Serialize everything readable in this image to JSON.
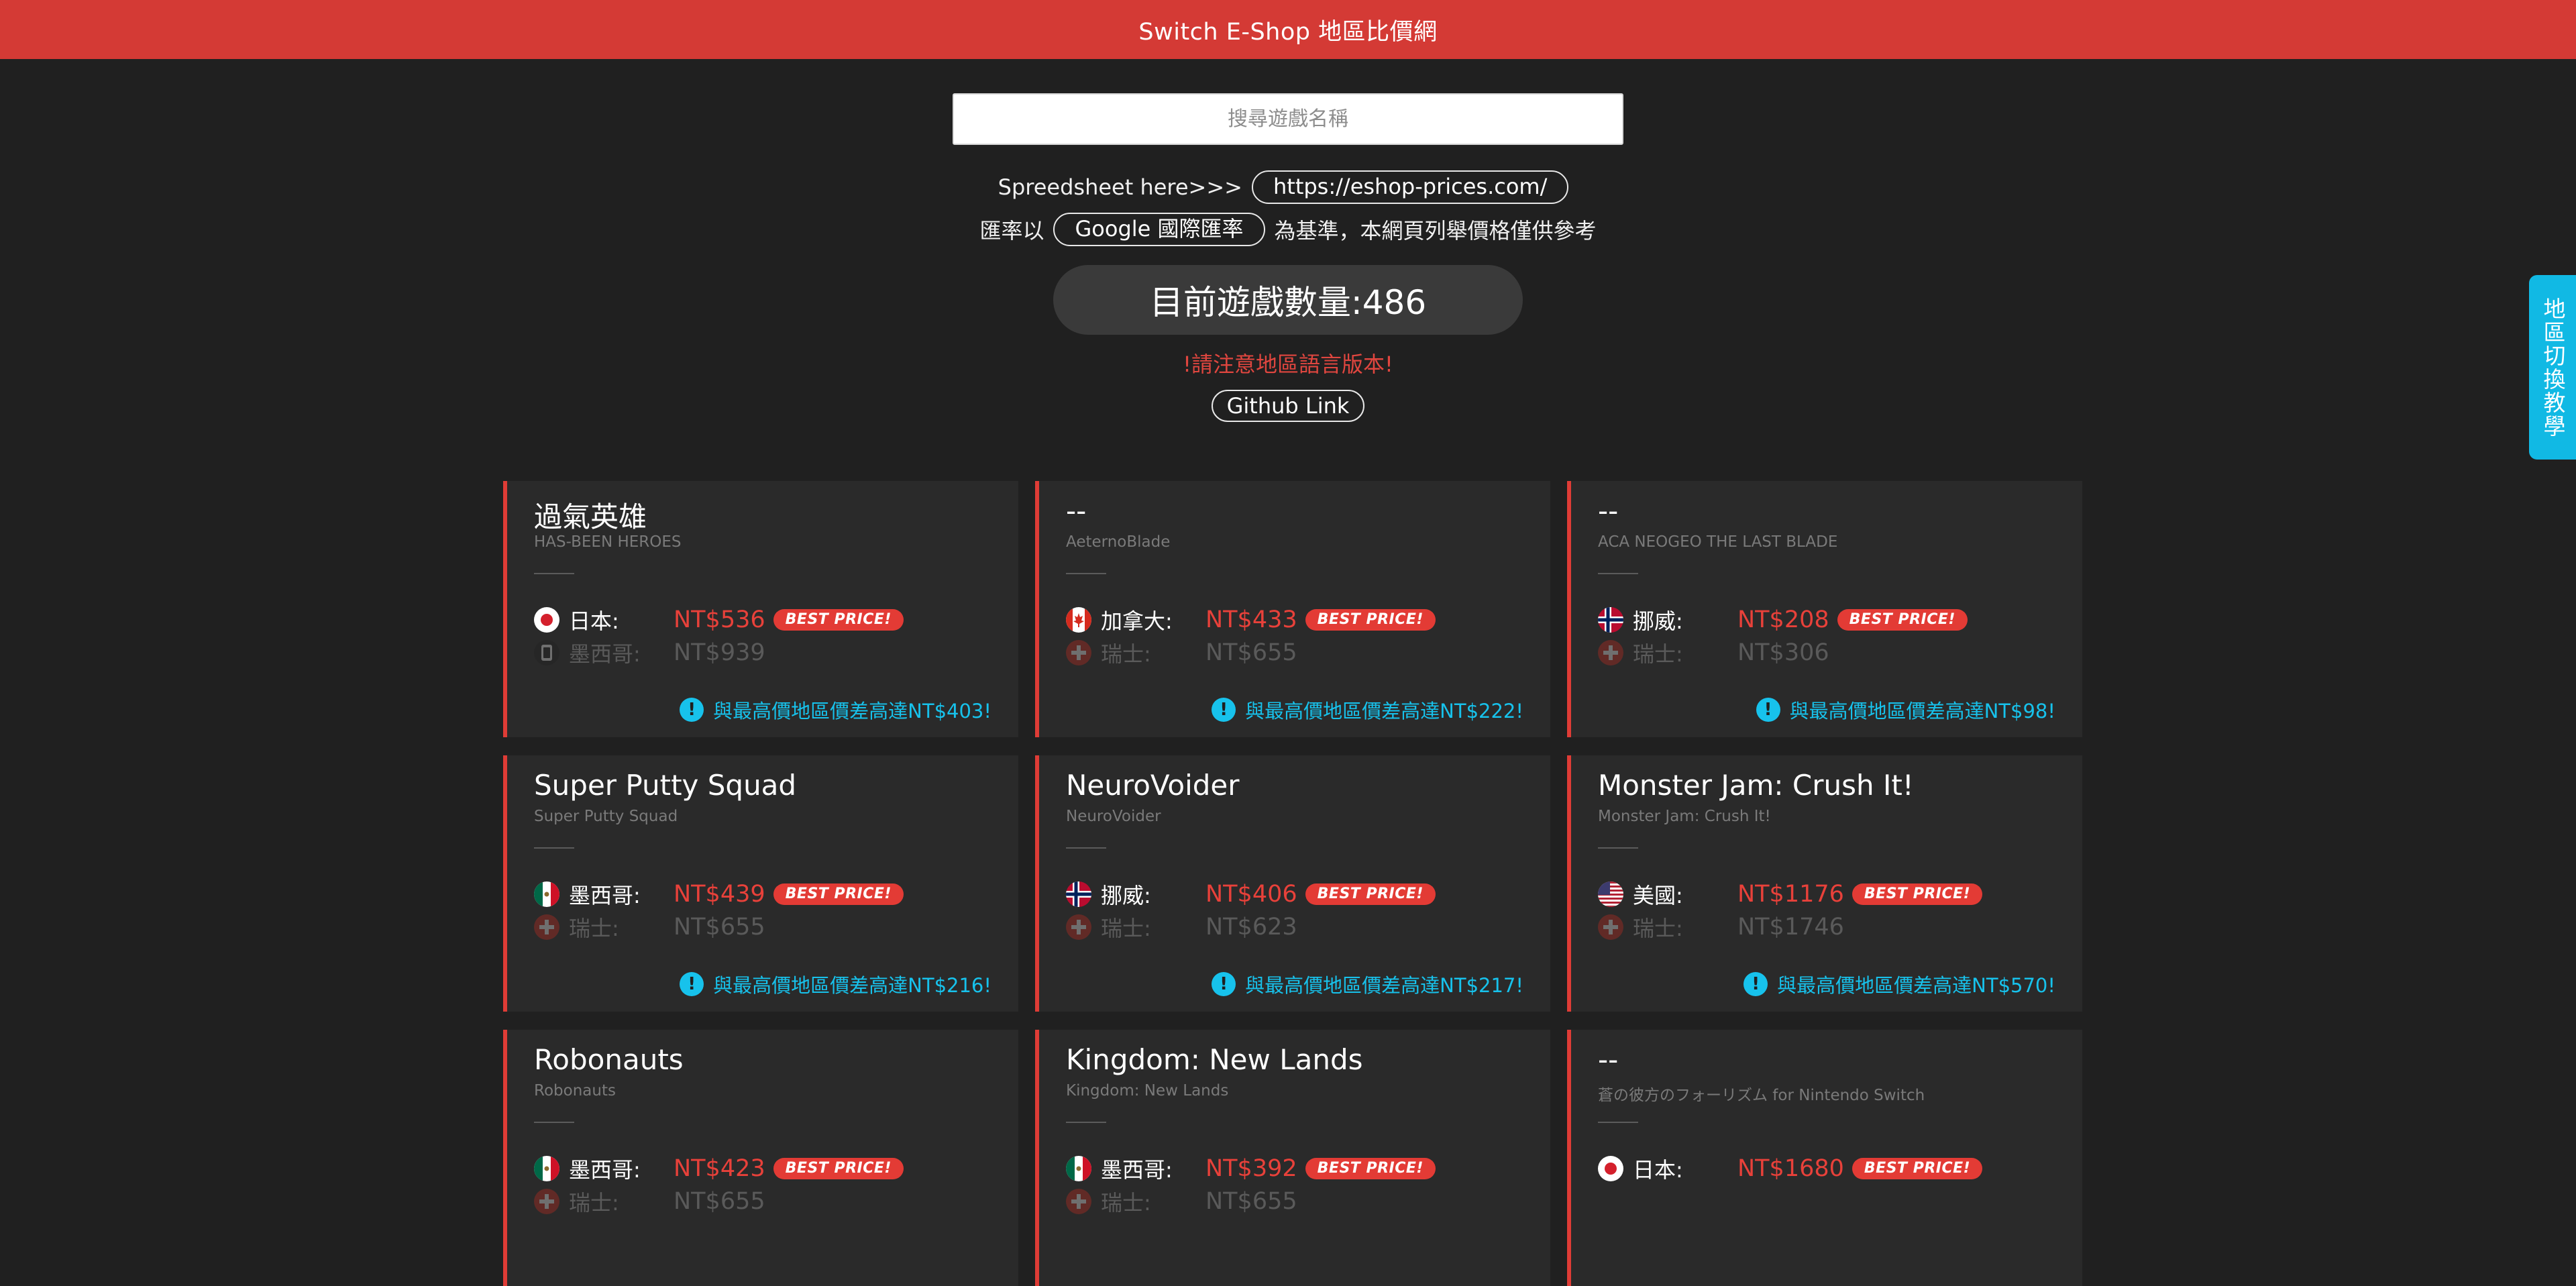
{
  "header": {
    "title": "Switch E-Shop 地區比價網"
  },
  "search": {
    "placeholder": "搜尋遊戲名稱"
  },
  "spreadsheet": {
    "label": "Spreedsheet here>>>",
    "link_text": "https://eshop-prices.com/"
  },
  "rate": {
    "prefix": "匯率以",
    "link_text": "Google 國際匯率",
    "suffix": "為基準，本網頁列舉價格僅供參考"
  },
  "game_count": {
    "text": "目前遊戲數量:486"
  },
  "notice": {
    "text": "!請注意地區語言版本!"
  },
  "github": {
    "label": "Github Link"
  },
  "side_tab": {
    "label": "地區切換教學"
  },
  "badge_text": "BEST PRICE!",
  "colors": {
    "accent": "#d43a35",
    "price": "#e8413a",
    "info": "#17c2ec",
    "background": "#202020",
    "card": "#2a2a2a"
  },
  "cards": [
    {
      "title": "過氣英雄",
      "subtitle": "HAS-BEEN HEROES",
      "best": {
        "flag": "japan-flag-icon",
        "country": "日本:",
        "price": "NT$536"
      },
      "worst": {
        "flag": "switch-icon",
        "country": "墨西哥:",
        "price": "NT$939"
      },
      "diff": "與最高價地區價差高達NT$403!"
    },
    {
      "title": "--",
      "subtitle": "AeternoBlade",
      "best": {
        "flag": "canada-flag-icon",
        "country": "加拿大:",
        "price": "NT$433"
      },
      "worst": {
        "flag": "switzerland-flag-icon",
        "country": "瑞士:",
        "price": "NT$655"
      },
      "diff": "與最高價地區價差高達NT$222!"
    },
    {
      "title": "--",
      "subtitle": "ACA NEOGEO THE LAST BLADE",
      "best": {
        "flag": "norway-flag-icon",
        "country": "挪威:",
        "price": "NT$208"
      },
      "worst": {
        "flag": "switzerland-flag-icon",
        "country": "瑞士:",
        "price": "NT$306"
      },
      "diff": "與最高價地區價差高達NT$98!"
    },
    {
      "title": "Super Putty Squad",
      "subtitle": "Super Putty Squad",
      "best": {
        "flag": "mexico-flag-icon",
        "country": "墨西哥:",
        "price": "NT$439"
      },
      "worst": {
        "flag": "switzerland-flag-icon",
        "country": "瑞士:",
        "price": "NT$655"
      },
      "diff": "與最高價地區價差高達NT$216!"
    },
    {
      "title": "NeuroVoider",
      "subtitle": "NeuroVoider",
      "best": {
        "flag": "norway-flag-icon",
        "country": "挪威:",
        "price": "NT$406"
      },
      "worst": {
        "flag": "switzerland-flag-icon",
        "country": "瑞士:",
        "price": "NT$623"
      },
      "diff": "與最高價地區價差高達NT$217!"
    },
    {
      "title": "Monster Jam: Crush It!",
      "subtitle": "Monster Jam: Crush It!",
      "best": {
        "flag": "usa-flag-icon",
        "country": "美國:",
        "price": "NT$1176"
      },
      "worst": {
        "flag": "switzerland-flag-icon",
        "country": "瑞士:",
        "price": "NT$1746"
      },
      "diff": "與最高價地區價差高達NT$570!"
    },
    {
      "title": "Robonauts",
      "subtitle": "Robonauts",
      "best": {
        "flag": "mexico-flag-icon",
        "country": "墨西哥:",
        "price": "NT$423"
      },
      "worst": {
        "flag": "switzerland-flag-icon",
        "country": "瑞士:",
        "price": "NT$655"
      },
      "diff": ""
    },
    {
      "title": "Kingdom: New Lands",
      "subtitle": "Kingdom: New Lands",
      "best": {
        "flag": "mexico-flag-icon",
        "country": "墨西哥:",
        "price": "NT$392"
      },
      "worst": {
        "flag": "switzerland-flag-icon",
        "country": "瑞士:",
        "price": "NT$655"
      },
      "diff": ""
    },
    {
      "title": "--",
      "subtitle": "蒼の彼方のフォーリズム for Nintendo Switch",
      "best": {
        "flag": "japan-flag-icon",
        "country": "日本:",
        "price": "NT$1680"
      },
      "worst": null,
      "diff": ""
    }
  ]
}
